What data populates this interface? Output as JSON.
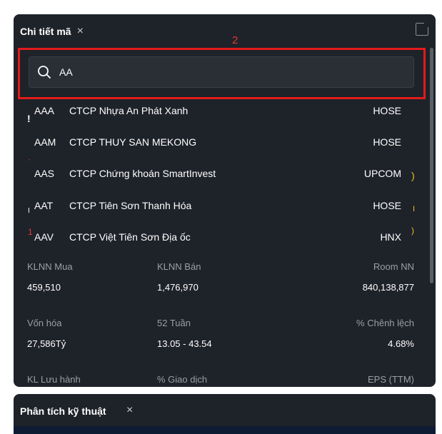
{
  "panel": {
    "title": "Chi tiết mã",
    "close": "×"
  },
  "annotation": {
    "label": "2"
  },
  "search": {
    "value": "AA"
  },
  "results": [
    {
      "code": "AAA",
      "name": "CTCP Nhựa An Phát Xanh",
      "exchange": "HOSE"
    },
    {
      "code": "AAM",
      "name": "CTCP THUY SAN MEKONG",
      "exchange": "HOSE"
    },
    {
      "code": "AAS",
      "name": "CTCP Chứng khoán SmartInvest",
      "exchange": "UPCOM"
    },
    {
      "code": "AAT",
      "name": "CTCP Tiên Sơn Thanh Hóa",
      "exchange": "HOSE"
    },
    {
      "code": "AAV",
      "name": "CTCP Việt Tiên Sơn Địa ốc",
      "exchange": "HNX"
    }
  ],
  "stats": {
    "klnn_mua": {
      "label": "KLNN Mua",
      "value": "459,510"
    },
    "klnn_ban": {
      "label": "KLNN Bán",
      "value": "1,476,970"
    },
    "room_nn": {
      "label": "Room NN",
      "value": "840,138,877"
    },
    "von_hoa": {
      "label": "Vốn hóa",
      "value": "27,586Tỷ"
    },
    "tuan52": {
      "label": "52 Tuần",
      "value": "13.05 - 43.54"
    },
    "chenh_lech": {
      "label": "% Chênh lệch",
      "value": "4.68%"
    },
    "kl_luu_hanh": {
      "label": "KL Lưu hành"
    },
    "giao_dich": {
      "label": "% Giao dịch"
    },
    "eps": {
      "label": "EPS (TTM)"
    }
  },
  "panel2": {
    "title": "Phân tích kỹ thuật",
    "close": "×"
  },
  "colors": {
    "panel_bg": "#1e2229",
    "highlight": "#e31b1b",
    "accent_red": "#e53935"
  }
}
